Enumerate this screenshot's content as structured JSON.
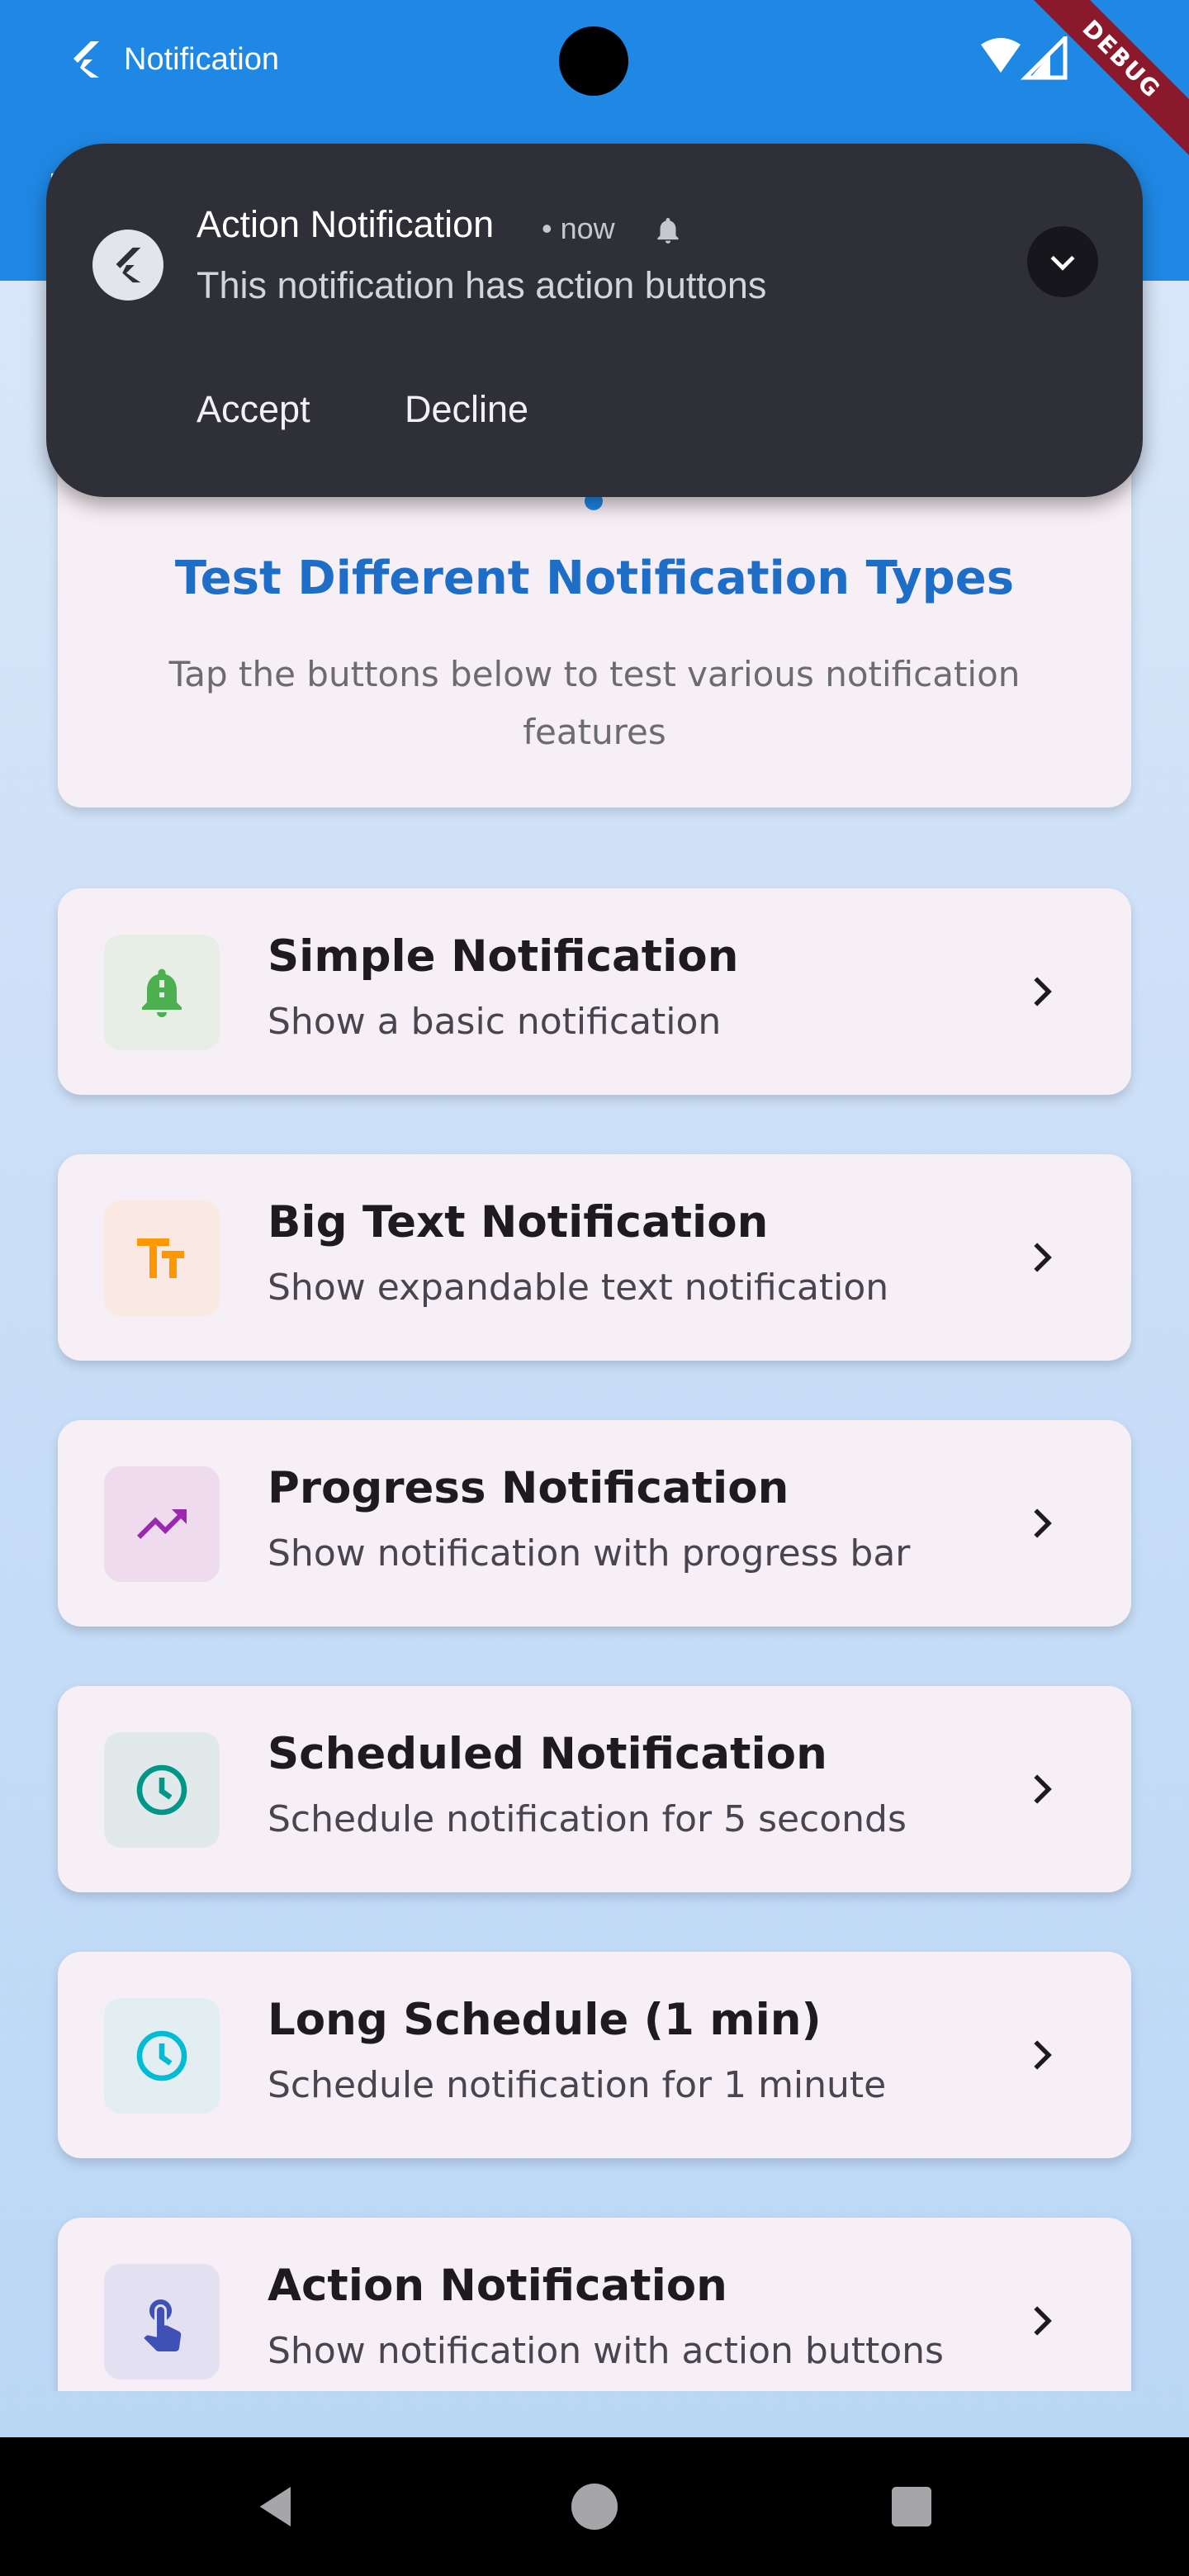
{
  "status_bar": {
    "app_title": "Notification",
    "debug_label": "DEBUG",
    "icons": [
      "flutter-logo-icon",
      "wifi-icon",
      "cellular-signal-icon"
    ]
  },
  "notification": {
    "title": "Action Notification",
    "meta": "• now",
    "body": "This notification has action buttons",
    "actions": [
      "Accept",
      "Decline"
    ],
    "icons": [
      "flutter-logo-icon",
      "bell-icon",
      "chevron-down-icon"
    ]
  },
  "header": {
    "title": "Test Different Notification Types",
    "subtitle": "Tap the buttons below to test various notification features"
  },
  "items": [
    {
      "title": "Simple Notification",
      "subtitle": "Show a basic notification",
      "icon": "bell-icon",
      "color": "#4caf50",
      "bg": "#e6eee6"
    },
    {
      "title": "Big Text Notification",
      "subtitle": "Show expandable text notification",
      "icon": "text-fields-icon",
      "color": "#ff9800",
      "bg": "#f9e9e2"
    },
    {
      "title": "Progress Notification",
      "subtitle": "Show notification with progress bar",
      "icon": "trending-up-icon",
      "color": "#9c27b0",
      "bg": "#eedcee"
    },
    {
      "title": "Scheduled Notification",
      "subtitle": "Schedule notification for 5 seconds",
      "icon": "clock-icon",
      "color": "#009688",
      "bg": "#e1e9eb"
    },
    {
      "title": "Long Schedule (1 min)",
      "subtitle": "Schedule notification for 1 minute",
      "icon": "clock-icon",
      "color": "#00bcd4",
      "bg": "#e3eef3"
    },
    {
      "title": "Action Notification",
      "subtitle": "Show notification with action buttons",
      "icon": "touch-icon",
      "color": "#3f51b5",
      "bg": "#e3e1f1"
    }
  ],
  "nav": {
    "buttons": [
      "back-icon",
      "home-icon",
      "recents-icon"
    ]
  }
}
